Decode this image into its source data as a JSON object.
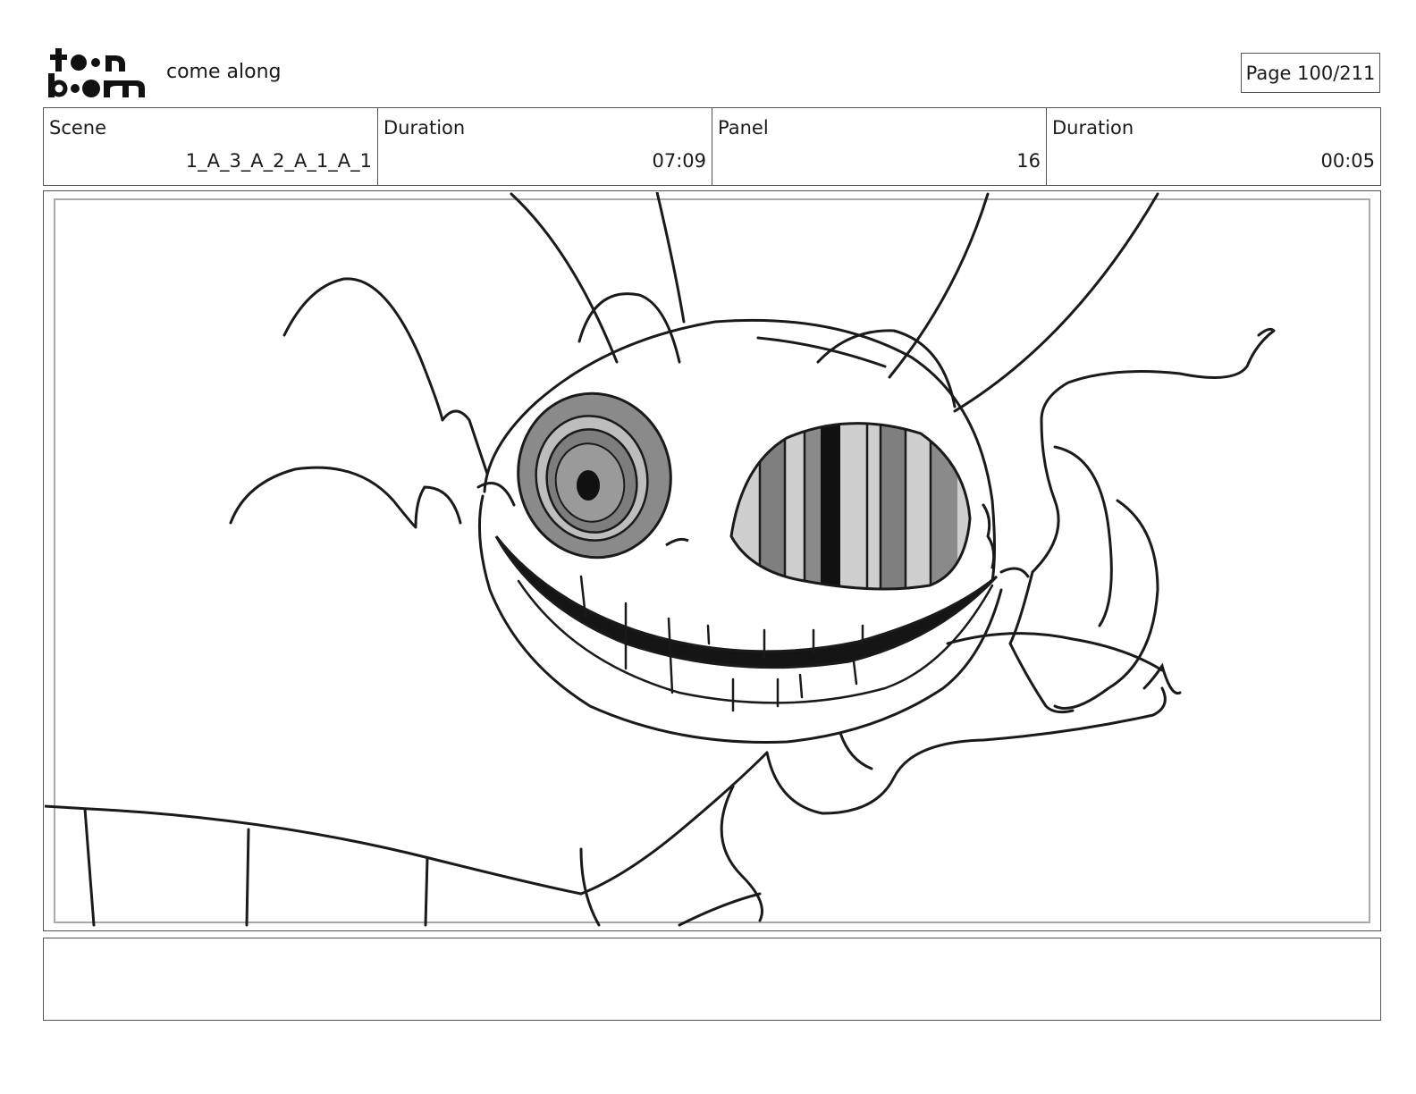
{
  "header": {
    "project_title": "come along",
    "page_label": "Page 100/211"
  },
  "info": {
    "scene_label": "Scene",
    "scene_value": "1_A_3_A_2_A_1_A_1",
    "scene_duration_label": "Duration",
    "scene_duration_value": "07:09",
    "panel_label": "Panel",
    "panel_value": "16",
    "panel_duration_label": "Duration",
    "panel_duration_value": "00:05"
  },
  "notes": {
    "text": ""
  }
}
